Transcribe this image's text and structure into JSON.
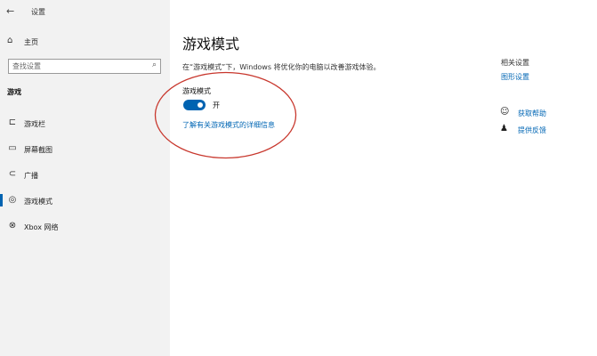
{
  "window": {
    "title": "设置",
    "back_icon": "back-arrow-icon"
  },
  "sidebar": {
    "home": {
      "label": "主页",
      "icon": "home-icon"
    },
    "search": {
      "placeholder": "查找设置",
      "icon": "search-icon"
    },
    "section": "游戏",
    "items": [
      {
        "label": "游戏栏",
        "icon": "game-bar-icon",
        "active": false
      },
      {
        "label": "屏幕截图",
        "icon": "capture-icon",
        "active": false
      },
      {
        "label": "广播",
        "icon": "broadcast-icon",
        "active": false
      },
      {
        "label": "游戏模式",
        "icon": "game-mode-icon",
        "active": true
      },
      {
        "label": "Xbox 网络",
        "icon": "xbox-icon",
        "active": false
      }
    ]
  },
  "main": {
    "title": "游戏模式",
    "description": "在“游戏模式”下，Windows 将优化你的电脑以改善游戏体验。",
    "setting_label": "游戏模式",
    "toggle": {
      "state": "开",
      "on": true
    },
    "link": "了解有关游戏模式的详细信息"
  },
  "related": {
    "title": "相关设置",
    "link": "图形设置"
  },
  "help": [
    {
      "label": "获取帮助",
      "icon": "help-chat-icon"
    },
    {
      "label": "提供反馈",
      "icon": "feedback-icon"
    }
  ],
  "colors": {
    "accent": "#0063b1",
    "link": "#0066b4",
    "annotation": "#c8372d"
  }
}
